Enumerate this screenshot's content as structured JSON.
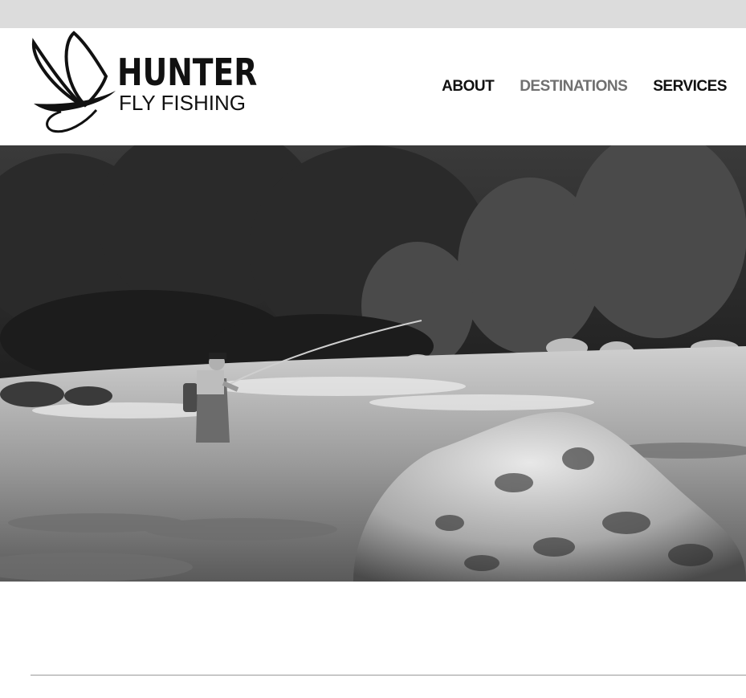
{
  "brand": {
    "name_line1": "HUNTER",
    "name_line2": "FLY FISHING",
    "logo_icon": "mayfly-wing-icon"
  },
  "nav": {
    "items": [
      {
        "label": "ABOUT",
        "active": false
      },
      {
        "label": "DESTINATIONS",
        "active": true
      },
      {
        "label": "SERVICES",
        "active": false
      }
    ]
  },
  "hero": {
    "image_subject": "angler-wading-river-photo"
  },
  "colors": {
    "nav_text": "#111111",
    "nav_active": "#707070",
    "top_strip": "#dcdcdc"
  }
}
